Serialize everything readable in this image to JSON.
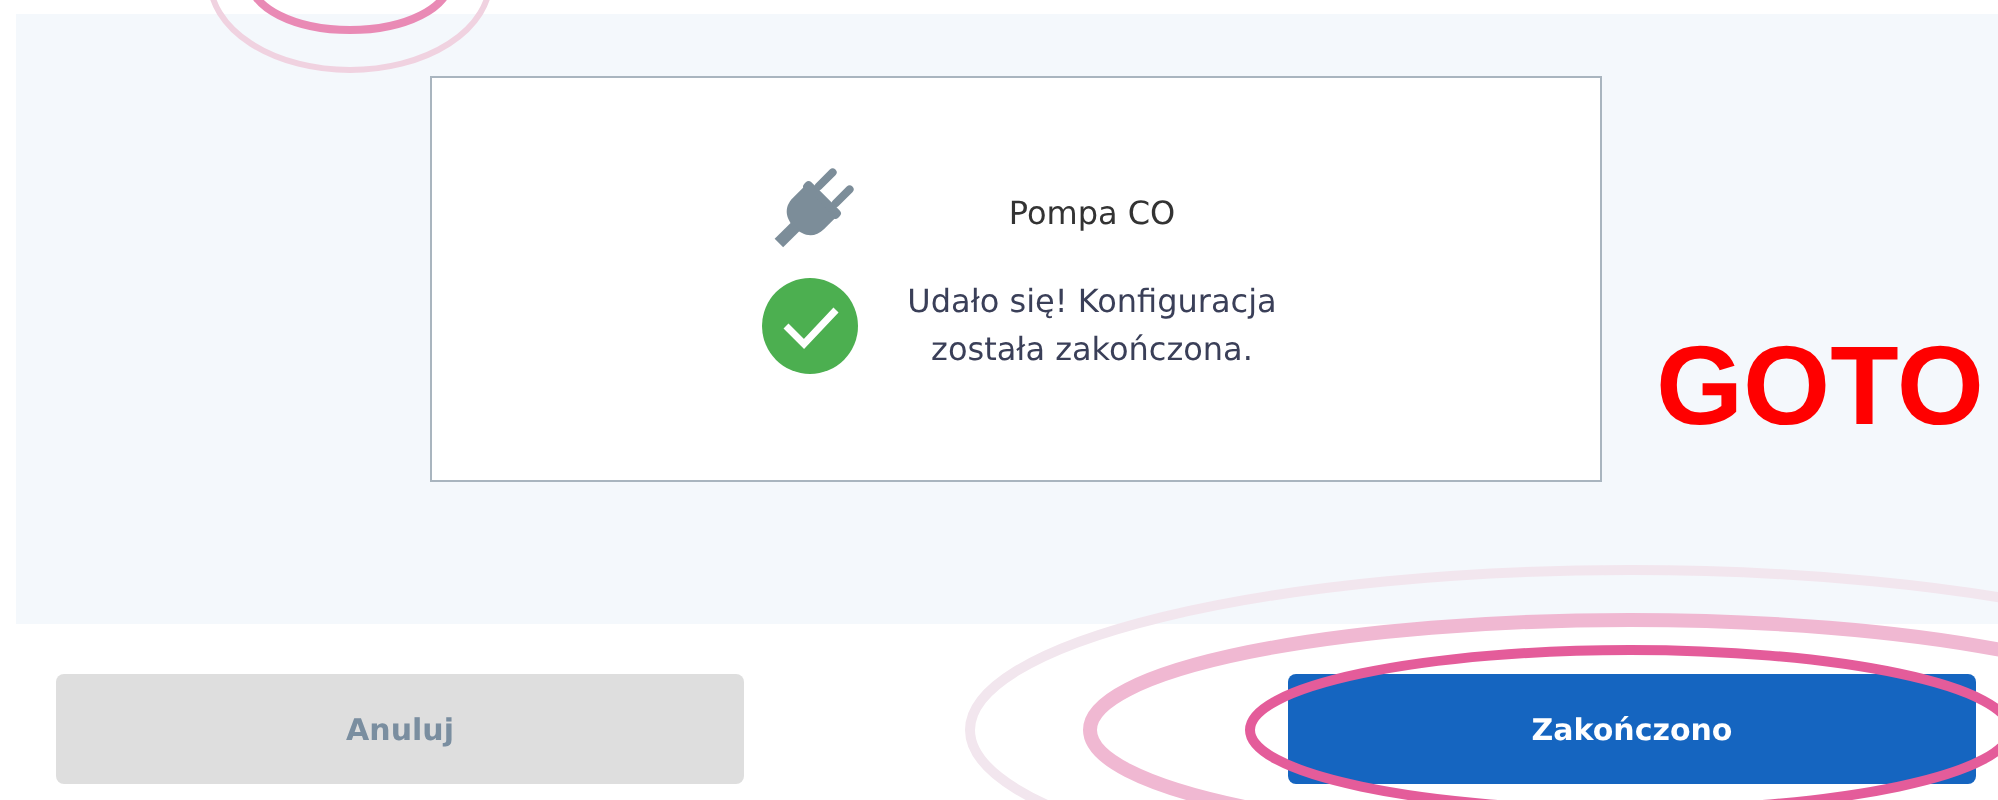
{
  "device": {
    "name": "Pompa CO",
    "succeeded": true,
    "message": "Udało się! Konfiguracja\nzostała zakończona."
  },
  "buttons": [
    {
      "label": "Anuluj",
      "kind": "secondary",
      "disabled": true
    },
    {
      "label": "Zakończono",
      "kind": "primary",
      "disabled": false
    }
  ],
  "annotation": {
    "text": "GOTO"
  }
}
